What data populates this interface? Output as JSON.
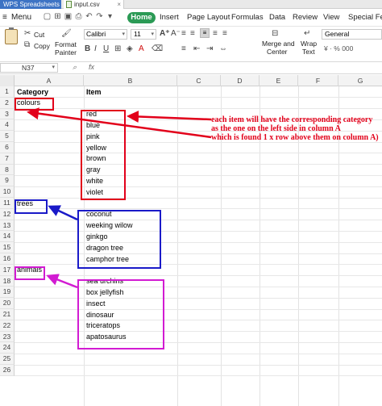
{
  "titlebar": {
    "app_tab": "WPS Spreadsheets",
    "file_tab": "input.csv",
    "close_glyph": "×"
  },
  "menubar": {
    "menu_label": "Menu",
    "tabs": [
      "Home",
      "Insert",
      "Page Layout",
      "Formulas",
      "Data",
      "Review",
      "View",
      "Special Feat"
    ]
  },
  "ribbon": {
    "cut": "Cut",
    "copy": "Copy",
    "format_painter": [
      "Format",
      "Painter"
    ],
    "font_name": "Calibri",
    "font_size": "11",
    "merge_center": [
      "Merge and",
      "Center"
    ],
    "wrap_text": [
      "Wrap",
      "Text"
    ],
    "number_format": "General",
    "number_format_icons": "¥ · % 000",
    "font_style_icons": [
      "B",
      "I",
      "U"
    ]
  },
  "formula_bar": {
    "name_box": "N37",
    "fx": "fx"
  },
  "grid": {
    "columns": [
      "A",
      "B",
      "C",
      "D",
      "E",
      "F",
      "G"
    ],
    "rows": [
      "1",
      "2",
      "3",
      "4",
      "5",
      "6",
      "7",
      "8",
      "9",
      "10",
      "11",
      "12",
      "13",
      "14",
      "15",
      "16",
      "17",
      "18",
      "19",
      "20",
      "21",
      "22",
      "23",
      "24",
      "25",
      "26"
    ],
    "cells": {
      "A1": "Category",
      "B1": "Item",
      "A2": "colours",
      "B3": "red",
      "B4": "blue",
      "B5": "pink",
      "B6": "yellow",
      "B7": "brown",
      "B8": "gray",
      "B9": "white",
      "B10": "violet",
      "A11": "trees",
      "B12": "coconut",
      "B13": "weeking wilow",
      "B14": "ginkgo",
      "B15": "dragon tree",
      "B16": "camphor tree",
      "A17": "animals",
      "B18": "sea urchins",
      "B19": "box jellyfish",
      "B20": "insect",
      "B21": "dinosaur",
      "B22": "triceratops",
      "B23": "apatosaurus"
    }
  },
  "annotation": {
    "note_lines": [
      "each item will have the corresponding category",
      "as the one on the left side in column A",
      "which is found 1 x row above them on column A)"
    ],
    "colors": {
      "colours": "#e2001a",
      "trees": "#1a1ac8",
      "animals": "#d21bd2",
      "home_tab": "#2b9a55",
      "app_tab": "#3d73c4"
    }
  }
}
